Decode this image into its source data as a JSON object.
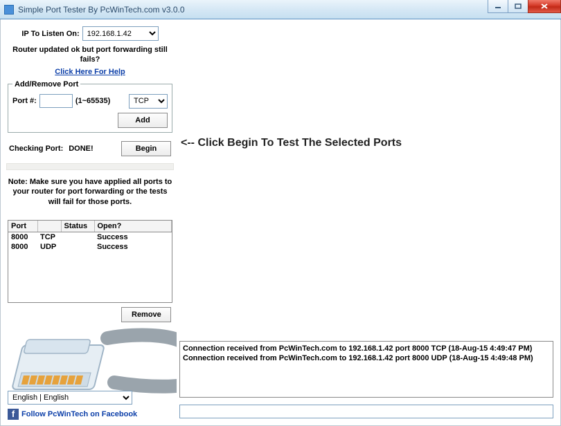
{
  "window": {
    "title": "Simple Port Tester By PcWinTech.com v3.0.0"
  },
  "ip": {
    "label": "IP To Listen On:",
    "value": "192.168.1.42"
  },
  "router_msg": "Router updated ok but port forwarding still fails?",
  "help_link": "Click Here For Help",
  "addremove": {
    "legend": "Add/Remove Port",
    "port_label": "Port #:",
    "port_value": "",
    "range": "(1~65535)",
    "proto": "TCP",
    "add": "Add"
  },
  "checking": {
    "label": "Checking Port:",
    "status": "DONE!",
    "begin": "Begin"
  },
  "note": "Note: Make sure you have applied all ports to your router for port forwarding or the tests will fail for those ports.",
  "table": {
    "headers": [
      "Port",
      "",
      "Status",
      "Open?"
    ],
    "rows": [
      {
        "port": "8000",
        "proto": "TCP",
        "status": "",
        "open": "Success"
      },
      {
        "port": "8000",
        "proto": "UDP",
        "status": "",
        "open": "Success"
      }
    ]
  },
  "remove": "Remove",
  "instruction": "<-- Click Begin To Test The Selected Ports",
  "log": {
    "lines": [
      "Connection received from PcWinTech.com to 192.168.1.42 port 8000 TCP (18-Aug-15 4:49:47 PM)",
      "Connection received from PcWinTech.com to 192.168.1.42 port 8000 UDP (18-Aug-15 4:49:48 PM)"
    ]
  },
  "language": "English | English",
  "facebook": "Follow PcWinTech on Facebook",
  "bottom_input": ""
}
